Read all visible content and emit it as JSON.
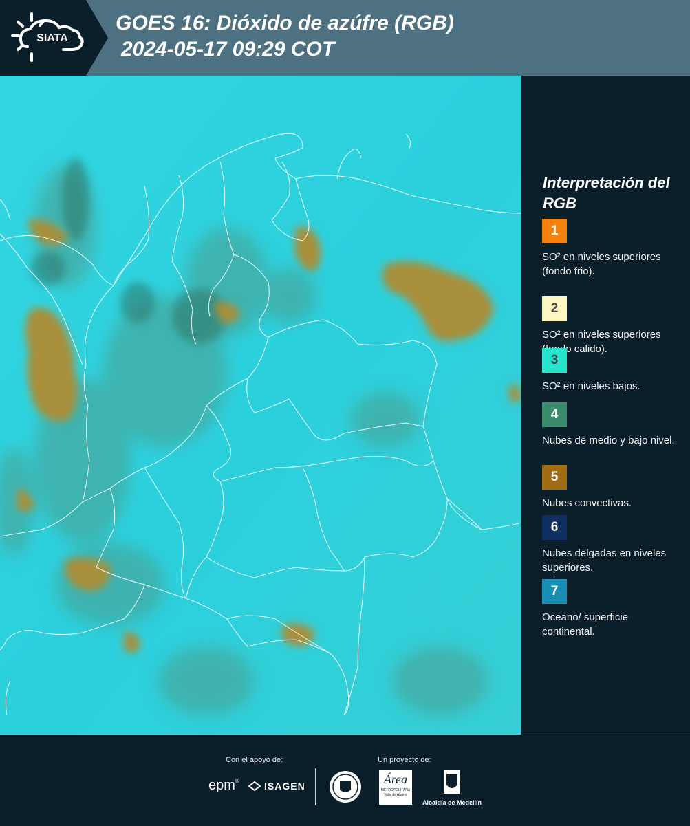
{
  "header": {
    "logo_text": "SIATA",
    "title_line1": "GOES 16: Dióxido de azúfre (RGB)",
    "title_line2": "2024-05-17 09:29 COT",
    "colors": {
      "bar": "#4d7181",
      "logo_bg": "#0b1f2b"
    }
  },
  "map": {
    "colors": {
      "background": "#2dd3e0",
      "convective": "#a88f3a",
      "low_mid_cloud": "#4e9b8c",
      "borders": "#ffffff"
    }
  },
  "legend": {
    "title": "Interpretación del RGB",
    "items": [
      {
        "number": "1",
        "color": "#f5820f",
        "number_color": "#ffffff",
        "description": "SO² en niveles superiores (fondo frio)."
      },
      {
        "number": "2",
        "color": "#fdf6c3",
        "number_color": "#4a4a4a",
        "description": "SO² en niveles superiores (fondo calido)."
      },
      {
        "number": "3",
        "color": "#27e4cd",
        "number_color": "#2a4a55",
        "description": "SO² en niveles bajos."
      },
      {
        "number": "4",
        "color": "#3a8c6c",
        "number_color": "#ffffff",
        "description": "Nubes de medio y bajo nivel."
      },
      {
        "number": "5",
        "color": "#a26d12",
        "number_color": "#ffffff",
        "description": "Nubes convectivas."
      },
      {
        "number": "6",
        "color": "#0f2f63",
        "number_color": "#ffffff",
        "description": "Nubes delgadas en niveles superiores."
      },
      {
        "number": "7",
        "color": "#1a8fb5",
        "number_color": "#ffffff",
        "description": "Oceano/ superficie continental."
      }
    ]
  },
  "footer": {
    "support_label": "Con el apoyo de:",
    "project_label": "Un proyecto de:",
    "sponsors": {
      "epm": "epm",
      "isagen": "ISAGEN",
      "area_metro": "Área",
      "area_metro_sub": "METROPOLITANA",
      "area_metro_sub2": "Valle de Aburrá",
      "alcaldia": "Alcaldía de Medellín"
    }
  }
}
